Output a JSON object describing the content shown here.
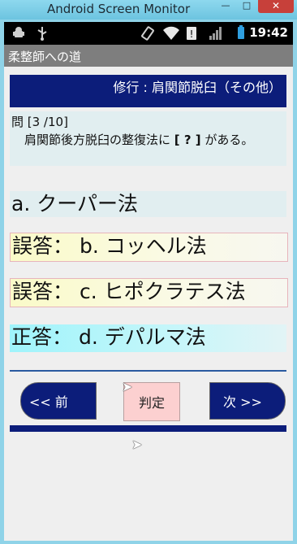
{
  "window": {
    "title": "Android Screen Monitor",
    "minimize": "—",
    "maximize": "□",
    "close": "✕"
  },
  "status_bar": {
    "time": "19:42",
    "icons": [
      "android-debug-icon",
      "usb-icon",
      "rotation-icon",
      "wifi-icon",
      "alert-icon",
      "signal-icon",
      "battery-icon"
    ]
  },
  "app": {
    "title": "柔整師への道"
  },
  "header": {
    "text": "修行 : 肩関節脱臼（その他）"
  },
  "question": {
    "number": "問 [3 /10]",
    "text_prefix": "肩関節後方脱臼の整復法に ",
    "blank": "[ ? ]",
    "text_suffix": " がある。"
  },
  "answers": [
    {
      "label": "a. クーパー法"
    },
    {
      "label": "誤答： b. コッヘル法"
    },
    {
      "label": "誤答： c. ヒポクラテス法"
    },
    {
      "label": "正答： d. デパルマ法"
    }
  ],
  "buttons": {
    "prev": "<< 前",
    "judge": "判定",
    "next": "次 >>"
  }
}
